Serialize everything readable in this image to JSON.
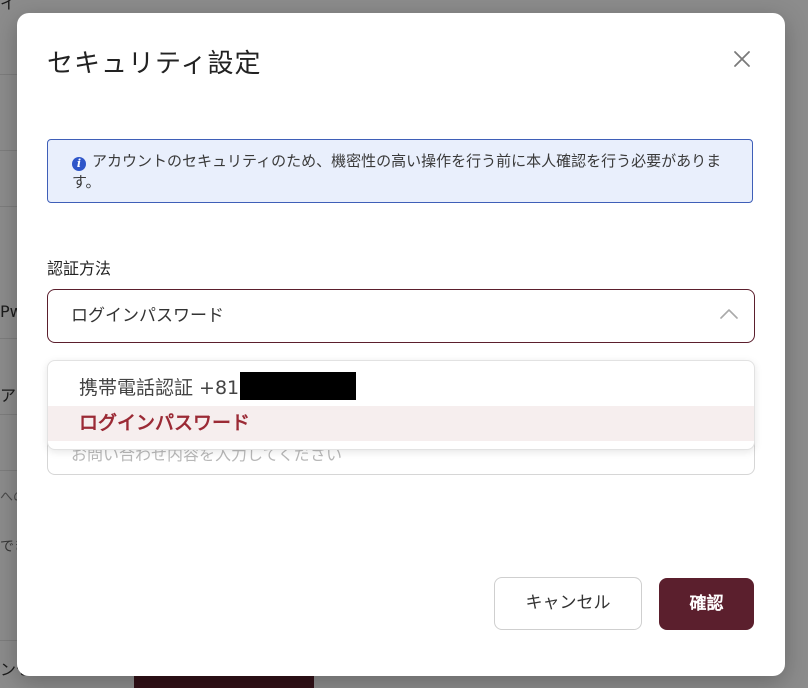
{
  "background": {
    "fragments": [
      "イ",
      "Pw",
      "ア",
      "への",
      "でき",
      "ンセ"
    ]
  },
  "modal": {
    "title": "セキュリティ設定",
    "close_icon": "close-icon",
    "info": {
      "icon": "info-icon",
      "icon_glyph": "i",
      "text": "アカウントのセキュリティのため、機密性の高い操作を行う前に本人確認を行う必要があります。"
    },
    "auth_method": {
      "label": "認証方法",
      "selected_value": "ログインパスワード",
      "options": [
        {
          "label": "携帯電話認証 +81",
          "masked": true
        },
        {
          "label": "ログインパスワード",
          "selected": true
        }
      ]
    },
    "inquiry": {
      "placeholder": "お問い合わせ内容を入力してください"
    },
    "buttons": {
      "cancel": "キャンセル",
      "confirm": "確認"
    }
  },
  "colors": {
    "primary": "#5b1f2d",
    "selected_text": "#9b2a35",
    "info_border": "#3f5fb8",
    "info_bg": "#e9effc"
  }
}
